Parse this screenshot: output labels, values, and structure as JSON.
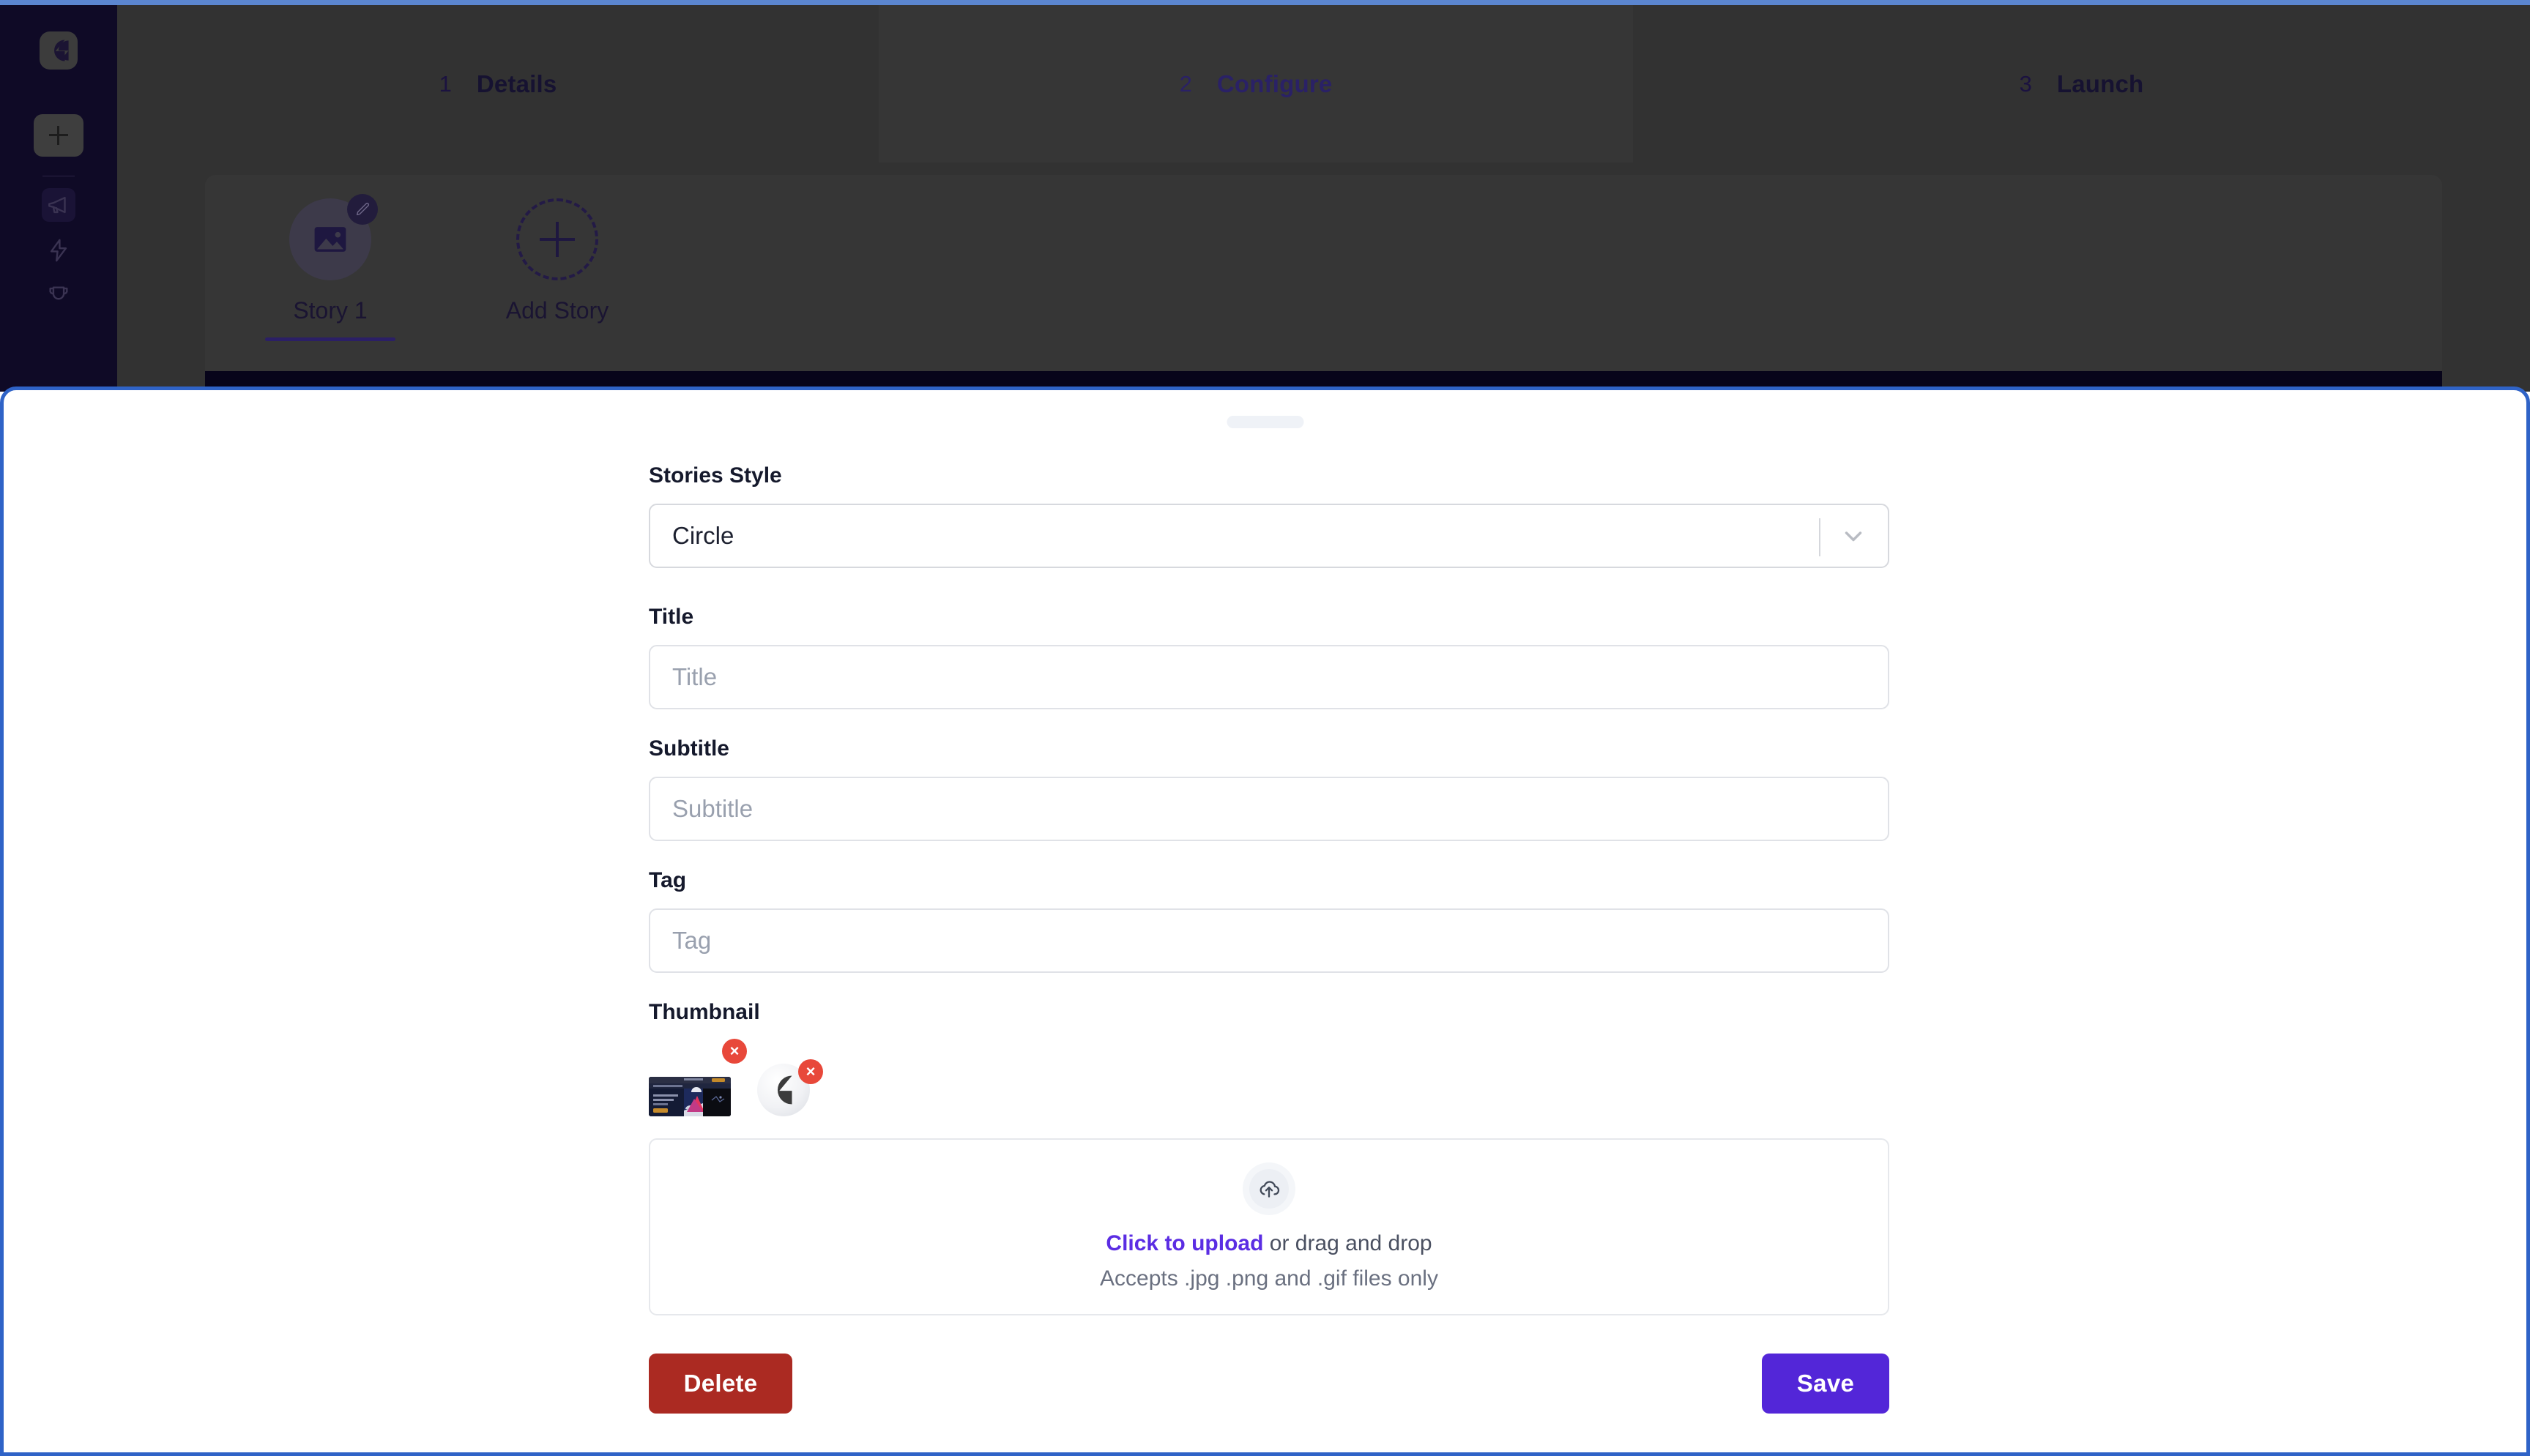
{
  "window": {
    "focus_border_color": "#2f63c7",
    "overlay_color": "#323232"
  },
  "sidebar": {
    "logo": {
      "name": "brand-logo",
      "color": "#1b1433"
    },
    "add_button": {
      "label": "+",
      "name": "add-button"
    },
    "items": [
      {
        "name": "megaphone-icon",
        "label": "Campaigns",
        "active": true
      },
      {
        "name": "lightning-icon",
        "label": "Automations",
        "active": false
      },
      {
        "name": "trophy-icon",
        "label": "Rewards",
        "active": false
      }
    ]
  },
  "stepper": {
    "active_index": 1,
    "active_color": "#2a2166",
    "steps": [
      {
        "num": "1",
        "label": "Details"
      },
      {
        "num": "2",
        "label": "Configure"
      },
      {
        "num": "3",
        "label": "Launch"
      }
    ]
  },
  "stories": {
    "items": [
      {
        "name": "Story 1",
        "selected": true,
        "badge": "edit-icon"
      }
    ],
    "add_label": "Add Story"
  },
  "modal": {
    "drag_handle": true,
    "fields": {
      "stories_style": {
        "label": "Stories Style",
        "value": "Circle",
        "options": [
          "Circle"
        ]
      },
      "title": {
        "label": "Title",
        "value": "",
        "placeholder": "Title"
      },
      "subtitle": {
        "label": "Subtitle",
        "value": "",
        "placeholder": "Subtitle"
      },
      "tag": {
        "label": "Tag",
        "value": "",
        "placeholder": "Tag"
      },
      "thumbnail": {
        "label": "Thumbnail",
        "items": [
          {
            "type": "rect",
            "name": "thumbnail-preview-1",
            "remove_label": "×"
          },
          {
            "type": "circle",
            "name": "thumbnail-preview-2",
            "remove_label": "×"
          }
        ]
      }
    },
    "dropzone": {
      "link_text": "Click to upload",
      "rest_text": " or drag and drop",
      "hint": "Accepts .jpg .png and .gif files only",
      "icon": "cloud-upload-icon",
      "link_color": "#5b2de3"
    },
    "actions": {
      "delete_label": "Delete",
      "delete_color": "#ab2a22",
      "save_label": "Save",
      "save_color": "#5326d8"
    }
  }
}
